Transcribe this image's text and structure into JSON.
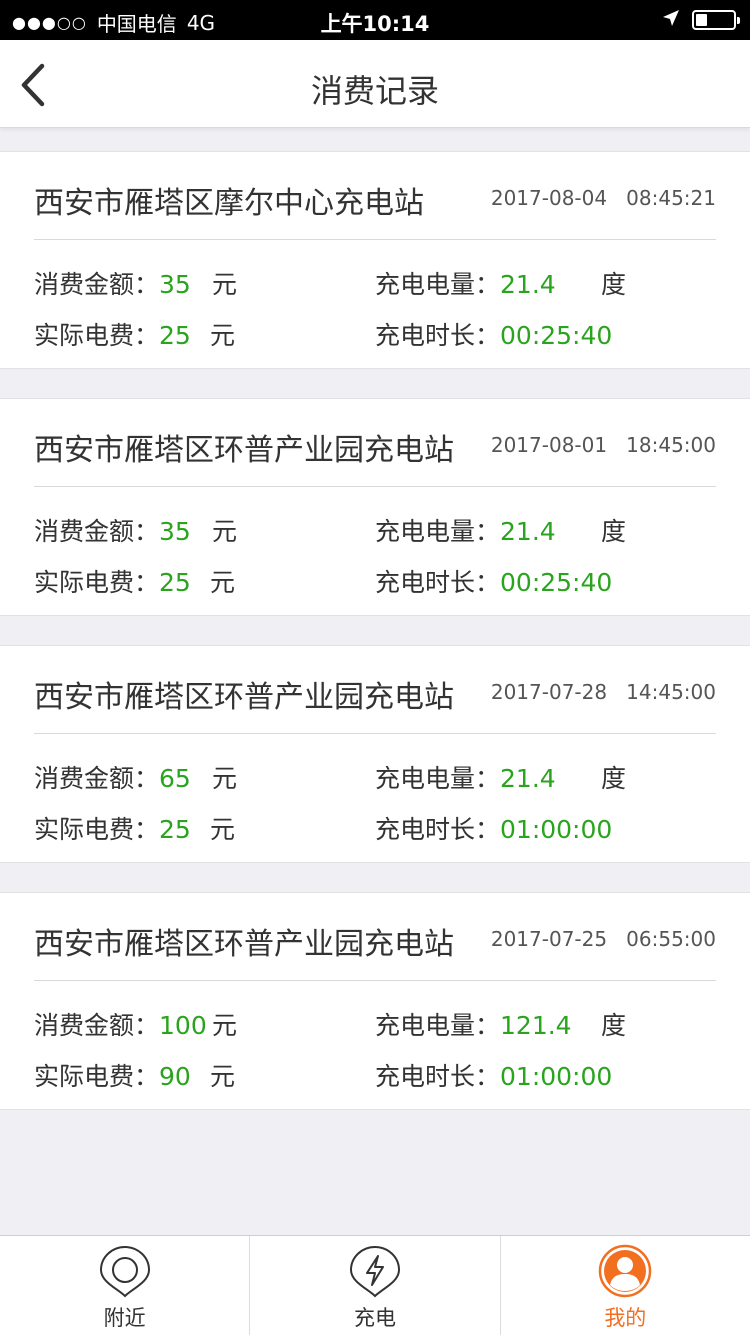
{
  "status_bar": {
    "signal": "●●●○○",
    "carrier": "中国电信",
    "network": "4G",
    "time": "上午10:14"
  },
  "nav": {
    "title": "消费记录"
  },
  "labels": {
    "amount": "消费金额：",
    "actual": "实际电费：",
    "energy": "充电电量：",
    "duration": "充电时长：",
    "yuan": "元",
    "degree": "度"
  },
  "records": [
    {
      "station": "西安市雁塔区摩尔中心充电站",
      "date": "2017-08-04",
      "time": "08:45:21",
      "amount": "35",
      "actual": "25",
      "energy": "21.4",
      "duration": "00:25:40"
    },
    {
      "station": "西安市雁塔区环普产业园充电站",
      "date": "2017-08-01",
      "time": "18:45:00",
      "amount": "35",
      "actual": "25",
      "energy": "21.4",
      "duration": "00:25:40"
    },
    {
      "station": "西安市雁塔区环普产业园充电站",
      "date": "2017-07-28",
      "time": "14:45:00",
      "amount": "65",
      "actual": "25",
      "energy": "21.4",
      "duration": "01:00:00"
    },
    {
      "station": "西安市雁塔区环普产业园充电站",
      "date": "2017-07-25",
      "time": "06:55:00",
      "amount": "100",
      "actual": "90",
      "energy": "121.4",
      "duration": "01:00:00"
    }
  ],
  "tabs": [
    {
      "label": "附近",
      "icon": "location-pin-icon"
    },
    {
      "label": "充电",
      "icon": "lightning-icon"
    },
    {
      "label": "我的",
      "icon": "user-profile-icon",
      "active": true
    }
  ],
  "colors": {
    "value_green": "#2aa41e",
    "accent_orange": "#f36f20"
  }
}
